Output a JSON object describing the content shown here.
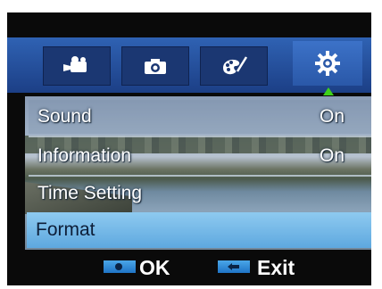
{
  "tabs": [
    {
      "icon": "video-camera-icon"
    },
    {
      "icon": "camera-icon"
    },
    {
      "icon": "palette-icon"
    },
    {
      "icon": "gear-icon",
      "selected": true
    }
  ],
  "menu": {
    "items": [
      {
        "label": "Sound",
        "value": "On"
      },
      {
        "label": "Information",
        "value": "On"
      },
      {
        "label": "Time Setting",
        "value": ""
      },
      {
        "label": "Format",
        "value": "",
        "highlighted": true
      }
    ]
  },
  "footer": {
    "ok_label": "OK",
    "exit_label": "Exit"
  },
  "colors": {
    "tab_bar": "#2f62b3",
    "highlight": "#6fb6e8",
    "selector_arrow": "#3fd21a"
  }
}
